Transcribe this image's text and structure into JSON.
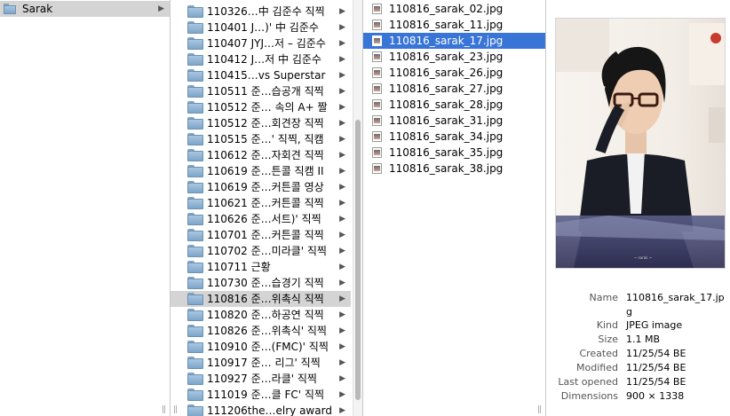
{
  "column1": {
    "items": [
      {
        "label": "Sarak",
        "selected": true
      }
    ]
  },
  "column2": {
    "items": [
      {
        "label": "110326…中 김준수 직찍"
      },
      {
        "label": "110401  J…)' 中 김준수"
      },
      {
        "label": "110407 JYJ…저 – 김준수"
      },
      {
        "label": "110412  J…저 中 김준수"
      },
      {
        "label": "110415…vs Superstar"
      },
      {
        "label": "110511 준…습공개 직찍"
      },
      {
        "label": "110512 준… 속의 A+ 짤"
      },
      {
        "label": "110512 준…회견장 직찍"
      },
      {
        "label": "110515 준…' 직찍, 직캠"
      },
      {
        "label": "110612 준…자회견 직찍"
      },
      {
        "label": "110619 준…튼콜 직캠 II"
      },
      {
        "label": "110619 준…커튼콜 영상"
      },
      {
        "label": "110621 준…커튼콜 직찍"
      },
      {
        "label": "110626 준…서트)' 직찍"
      },
      {
        "label": "110701 준…커튼콜 직찍"
      },
      {
        "label": "110702 준…미라클' 직찍"
      },
      {
        "label": "110711 근황"
      },
      {
        "label": "110730 준…습경기 직찍"
      },
      {
        "label": "110816 준…위촉식 직찍",
        "selected": true
      },
      {
        "label": "110820 준…하공연 직찍"
      },
      {
        "label": "110826 준…위촉식' 직찍"
      },
      {
        "label": "110910 준…(FMC)' 직찍"
      },
      {
        "label": "110917 준… 리그' 직찍"
      },
      {
        "label": "110927 준…라클' 직찍"
      },
      {
        "label": "111019 준…클 FC' 직찍"
      },
      {
        "label": "111206the…elry award"
      }
    ]
  },
  "column3": {
    "items": [
      {
        "label": "110816_sarak_02.jpg"
      },
      {
        "label": "110816_sarak_11.jpg"
      },
      {
        "label": "110816_sarak_17.jpg",
        "selected": true
      },
      {
        "label": "110816_sarak_23.jpg"
      },
      {
        "label": "110816_sarak_26.jpg"
      },
      {
        "label": "110816_sarak_27.jpg"
      },
      {
        "label": "110816_sarak_28.jpg"
      },
      {
        "label": "110816_sarak_31.jpg"
      },
      {
        "label": "110816_sarak_34.jpg"
      },
      {
        "label": "110816_sarak_35.jpg"
      },
      {
        "label": "110816_sarak_38.jpg"
      }
    ]
  },
  "preview": {
    "info": {
      "name_key": "Name",
      "name_val": "110816_sarak_17.jpg",
      "kind_key": "Kind",
      "kind_val": "JPEG image",
      "size_key": "Size",
      "size_val": "1.1 MB",
      "created_key": "Created",
      "created_val": "11/25/54 BE",
      "modified_key": "Modified",
      "modified_val": "11/25/54 BE",
      "opened_key": "Last opened",
      "opened_val": "11/25/54 BE",
      "dims_key": "Dimensions",
      "dims_val": "900 × 1338"
    }
  },
  "colors": {
    "selection_blue": "#3875d7",
    "selection_grey": "#d4d4d4"
  }
}
